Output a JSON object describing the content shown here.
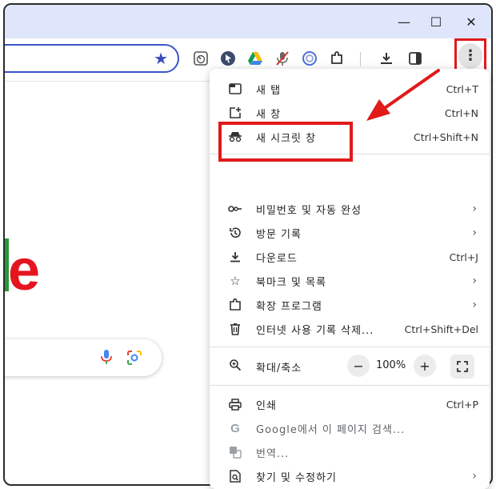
{
  "window": {
    "minimize_glyph": "—",
    "maximize_glyph": "☐",
    "close_glyph": "✕"
  },
  "toolbar": {
    "extension_icons": [
      "speedometer-icon",
      "cursor-icon",
      "drive-icon",
      "mic-muted-icon",
      "circle-icon",
      "puzzle-icon"
    ],
    "download_icon": "download-icon",
    "sidepanel_icon": "side-panel-icon",
    "menu_glyph": "⋮"
  },
  "page": {
    "logo_fragment": "e"
  },
  "menu": {
    "items": [
      {
        "label": "새 탭",
        "shortcut": "Ctrl+T",
        "icon": "new-tab-icon"
      },
      {
        "label": "새 창",
        "shortcut": "Ctrl+N",
        "icon": "new-window-icon"
      },
      {
        "label": "새 시크릿 창",
        "shortcut": "Ctrl+Shift+N",
        "icon": "incognito-icon"
      },
      {
        "label": "비밀번호 및 자동 완성",
        "shortcut": "",
        "icon": "key-icon",
        "submenu": true
      },
      {
        "label": "방문 기록",
        "shortcut": "",
        "icon": "history-icon",
        "submenu": true
      },
      {
        "label": "다운로드",
        "shortcut": "Ctrl+J",
        "icon": "download-icon"
      },
      {
        "label": "북마크 및 목록",
        "shortcut": "",
        "icon": "star-icon",
        "submenu": true
      },
      {
        "label": "확장 프로그램",
        "shortcut": "",
        "icon": "puzzle-icon",
        "submenu": true
      },
      {
        "label": "인터넷 사용 기록 삭제...",
        "shortcut": "Ctrl+Shift+Del",
        "icon": "trash-icon"
      }
    ],
    "zoom": {
      "label": "확대/축소",
      "value": "100%",
      "minus": "−",
      "plus": "+"
    },
    "tail_items": [
      {
        "label": "인쇄",
        "shortcut": "Ctrl+P",
        "icon": "print-icon"
      },
      {
        "label": "Google에서 이 페이지 검색...",
        "shortcut": "",
        "icon": "google-icon"
      },
      {
        "label": "번역...",
        "shortcut": "",
        "icon": "translate-icon"
      },
      {
        "label": "찾기 및 수정하기",
        "shortcut": "",
        "icon": "search-doc-icon",
        "submenu": true
      }
    ],
    "submenu_glyph": "›"
  },
  "colors": {
    "highlight": "#e11a1a",
    "titlebar": "#dfe6fb",
    "omnibox_border": "#3b55c9"
  }
}
